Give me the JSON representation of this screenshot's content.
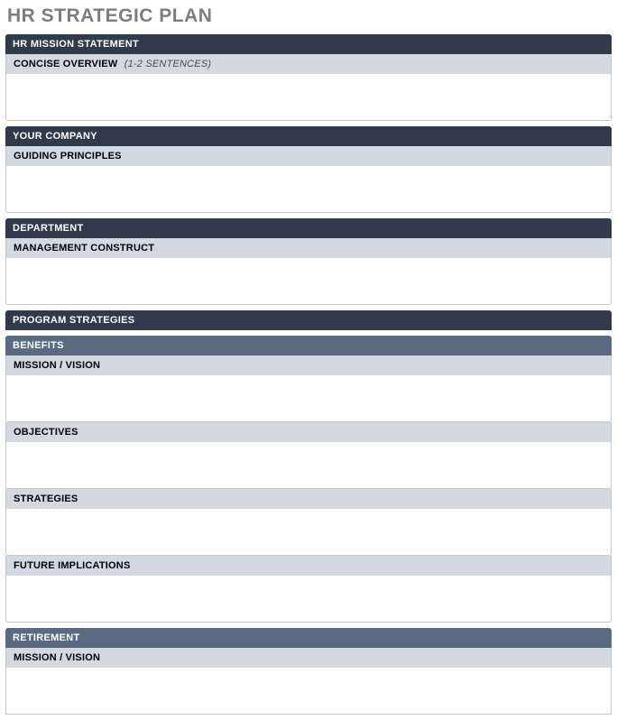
{
  "title": "HR STRATEGIC PLAN",
  "sections": {
    "mission": {
      "header": "HR MISSION STATEMENT",
      "subtitle": "CONCISE OVERVIEW",
      "hint": "(1-2 SENTENCES)"
    },
    "company": {
      "header": "YOUR COMPANY",
      "subtitle": "GUIDING PRINCIPLES"
    },
    "department": {
      "header": "DEPARTMENT",
      "subtitle": "MANAGEMENT CONSTRUCT"
    },
    "program": {
      "header": "PROGRAM STRATEGIES",
      "benefits": {
        "title": "BENEFITS",
        "rows": {
          "mission": "MISSION / VISION",
          "objectives": "OBJECTIVES",
          "strategies": "STRATEGIES",
          "future": "FUTURE IMPLICATIONS"
        }
      },
      "retirement": {
        "title": "RETIREMENT",
        "rows": {
          "mission": "MISSION / VISION"
        }
      }
    }
  }
}
